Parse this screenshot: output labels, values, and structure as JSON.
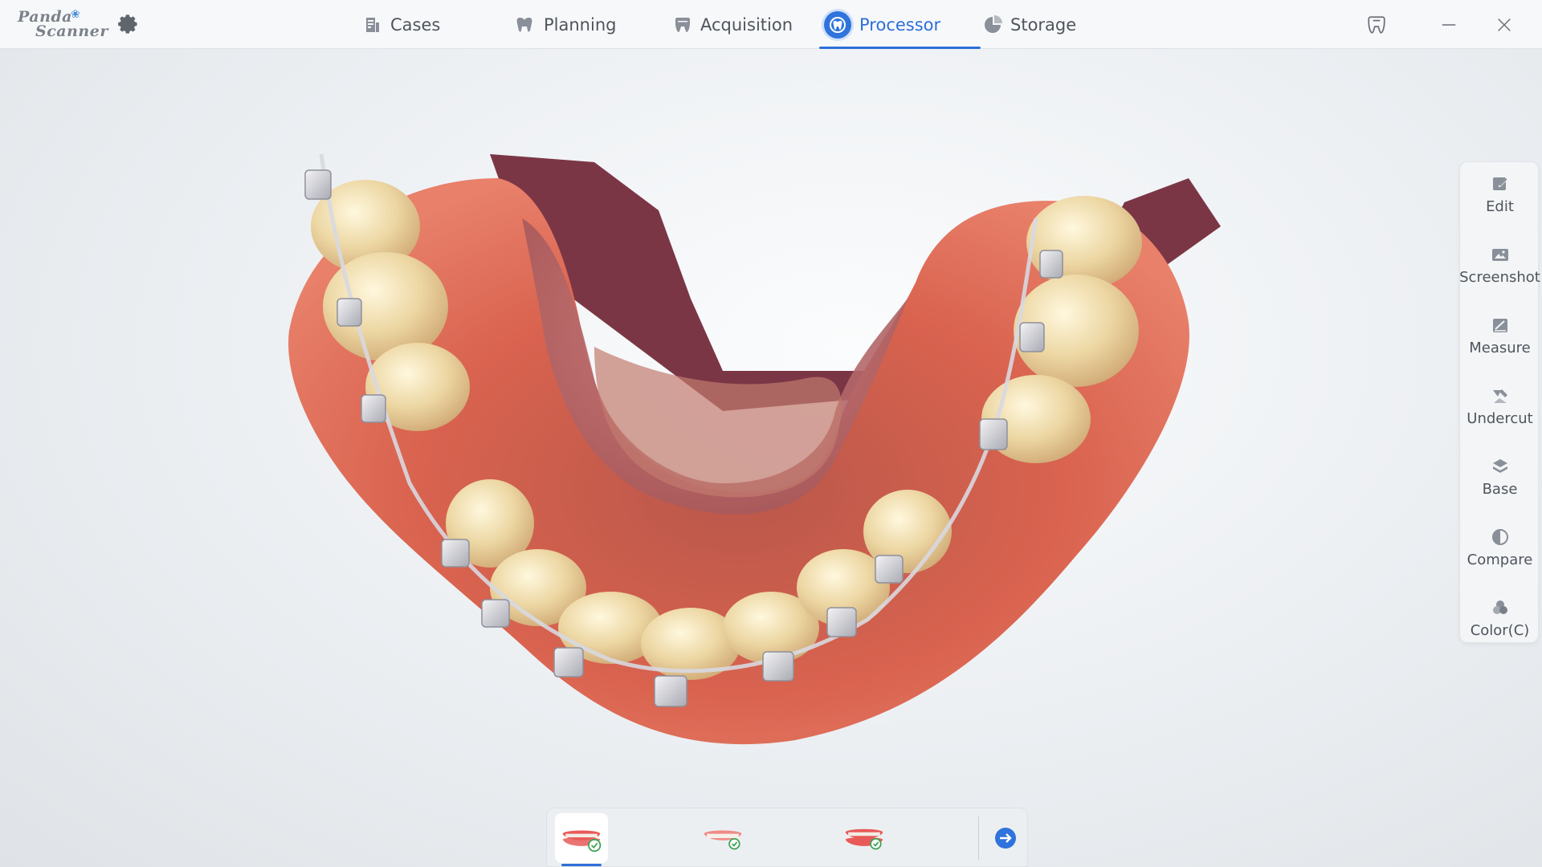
{
  "app": {
    "logo_line1": "Panda",
    "logo_line2": "Scanner"
  },
  "tabs": [
    {
      "label": "Cases",
      "icon": "cases-icon",
      "active": false
    },
    {
      "label": "Planning",
      "icon": "planning-icon",
      "active": false
    },
    {
      "label": "Acquisition",
      "icon": "acquisition-icon",
      "active": false
    },
    {
      "label": "Processor",
      "icon": "processor-icon",
      "active": true
    },
    {
      "label": "Storage",
      "icon": "storage-icon",
      "active": false
    }
  ],
  "tools": [
    {
      "label": "Edit",
      "icon": "edit-icon"
    },
    {
      "label": "Screenshot",
      "icon": "screenshot-icon"
    },
    {
      "label": "Measure",
      "icon": "measure-icon"
    },
    {
      "label": "Undercut",
      "icon": "undercut-icon"
    },
    {
      "label": "Base",
      "icon": "base-icon"
    },
    {
      "label": "Compare",
      "icon": "compare-icon"
    },
    {
      "label": "Color(C)",
      "icon": "color-icon"
    }
  ],
  "jaw_selector": [
    {
      "name": "lower-jaw",
      "status": "done",
      "active": true
    },
    {
      "name": "upper-jaw",
      "status": "done",
      "active": false
    },
    {
      "name": "bite",
      "status": "done",
      "active": false
    }
  ],
  "colors": {
    "accent": "#2d6fd8",
    "gum": "#d9604e",
    "tooth": "#ecd9a8",
    "palate": "#7e3a48"
  }
}
